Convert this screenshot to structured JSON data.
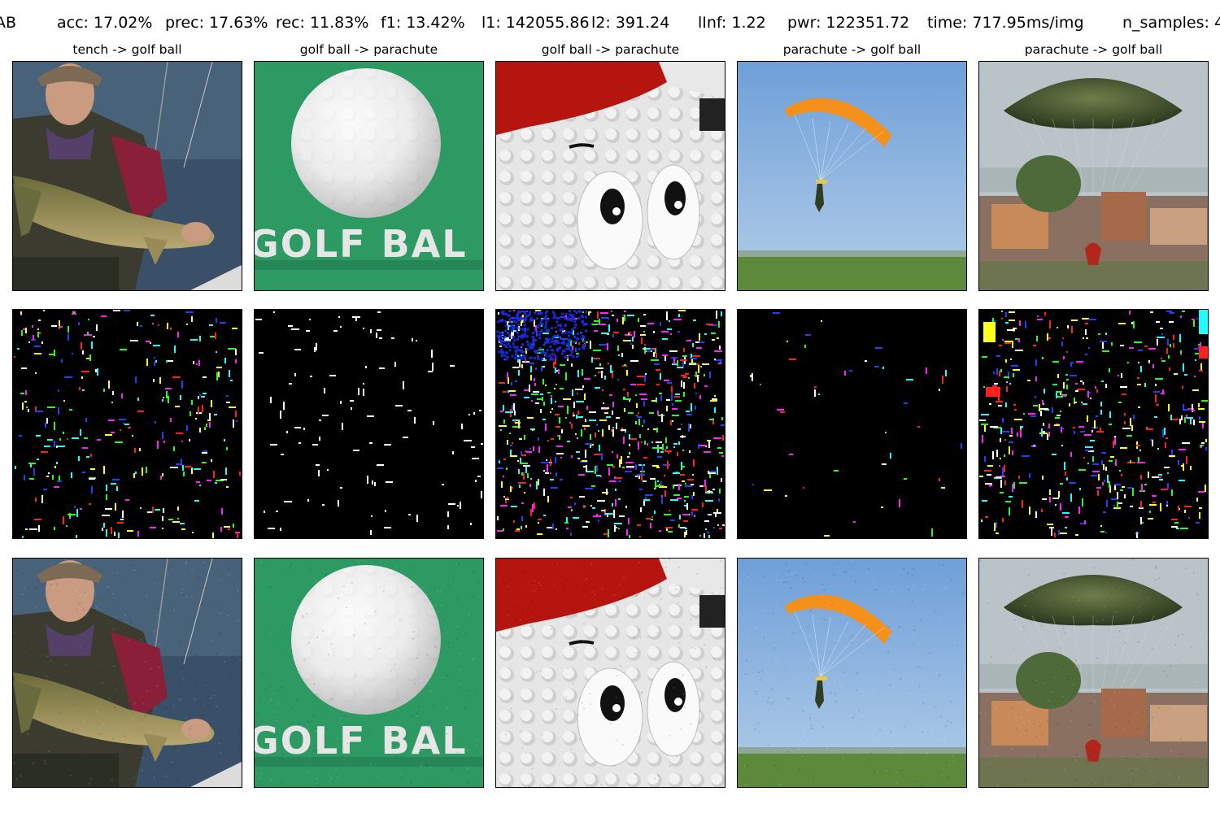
{
  "header": {
    "attack_label": "AB",
    "acc": "acc: 17.02%",
    "prec": "prec: 17.63%",
    "rec": "rec: 11.83%",
    "f1": "f1: 13.42%",
    "l1": "l1: 142055.86",
    "l2": "l2: 391.24",
    "linf": "lInf: 1.22",
    "pwr": "pwr: 122351.72",
    "time": "time: 717.95ms/img",
    "n_samples": "n_samples: 4"
  },
  "columns": [
    {
      "title": "tench -> golf ball",
      "original": "tench",
      "target": "golf ball"
    },
    {
      "title": "golf ball -> parachute",
      "original": "golf ball",
      "target": "parachute"
    },
    {
      "title": "golf ball -> parachute",
      "original": "golf ball",
      "target": "parachute"
    },
    {
      "title": "parachute -> golf ball",
      "original": "parachute",
      "target": "golf ball"
    },
    {
      "title": "parachute -> golf ball",
      "original": "parachute",
      "target": "golf ball"
    }
  ],
  "rows": [
    "original-image",
    "perturbation",
    "adversarial-image"
  ],
  "image_text": {
    "golf_ball_banner": "GOLF BAL"
  },
  "chart_data": {
    "type": "image-grid",
    "title": "AB  acc: 17.02%  prec: 17.63%  rec: 11.83%  f1: 13.42%  l1: 142055.86  l2: 391.24  lInf: 1.22  pwr: 122351.72  time: 717.95ms/img  n_samples: 4",
    "metrics": {
      "acc_pct": 17.02,
      "prec_pct": 17.63,
      "rec_pct": 11.83,
      "f1_pct": 13.42,
      "l1": 142055.86,
      "l2": 391.24,
      "linf": 1.22,
      "pwr": 122351.72,
      "time_ms_per_img": 717.95,
      "n_samples": 4
    },
    "columns": [
      "tench -> golf ball",
      "golf ball -> parachute",
      "golf ball -> parachute",
      "parachute -> golf ball",
      "parachute -> golf ball"
    ],
    "perturbation_density": [
      0.35,
      0.12,
      0.85,
      0.05,
      0.55
    ],
    "colors": {
      "perturbation_bg": "#000000",
      "speckle_palette": [
        "#ffffff",
        "#ff2020",
        "#20ff20",
        "#2040ff",
        "#ffff20",
        "#ff20ff",
        "#20ffff"
      ]
    }
  }
}
